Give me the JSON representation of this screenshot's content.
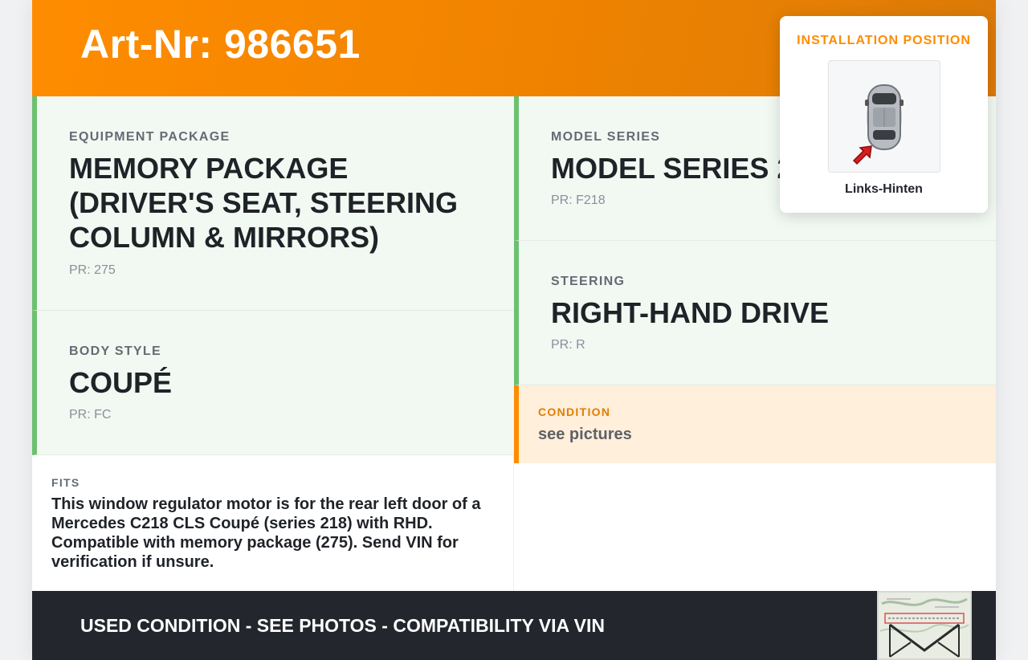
{
  "header": {
    "art_nr": "Art-Nr: 986651"
  },
  "cells": {
    "equipment": {
      "label": "EQUIPMENT PACKAGE",
      "value": "MEMORY PACKAGE (DRIVER'S SEAT, STEERING COLUMN & MIRRORS)",
      "pr": "PR: 275"
    },
    "model": {
      "label": "MODEL SERIES",
      "value": "MODEL SERIES 218",
      "pr": "PR: F218"
    },
    "body": {
      "label": "BODY STYLE",
      "value": "COUPÉ",
      "pr": "PR: FC"
    },
    "steering": {
      "label": "STEERING",
      "value": "RIGHT-HAND DRIVE",
      "pr": "PR: R"
    }
  },
  "condition": {
    "label": "CONDITION",
    "value": "see pictures"
  },
  "fits": {
    "label": "FITS",
    "text": "This window regulator motor is for the rear left door of a Mercedes C218 CLS Coupé (series 218) with RHD. Compatible with memory package (275). Send VIN for verification if unsure."
  },
  "footer": {
    "text": "USED CONDITION - SEE PHOTOS - COMPATIBILITY VIA VIN",
    "thumbnail_icon": "vin-document-envelope-icon"
  },
  "installation": {
    "title": "INSTALLATION POSITION",
    "caption": "Links-Hinten",
    "icon": "car-top-view-icon",
    "marker_icon": "red-arrow-icon"
  },
  "colors": {
    "accent": "#ff8c00",
    "green_border": "#6cc070",
    "green_bg": "#f2f8f2",
    "condition_bg": "#ffefdb",
    "footer_bg": "#23262d"
  }
}
